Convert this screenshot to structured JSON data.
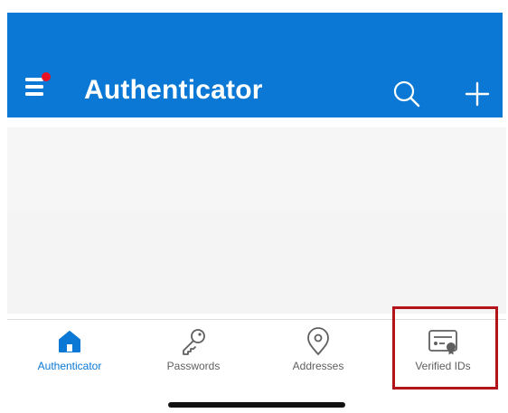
{
  "header": {
    "title": "Authenticator",
    "menu_icon": "hamburger-menu-icon",
    "notification_dot_color": "#e81123",
    "search_icon": "search-icon",
    "add_icon": "plus-icon",
    "background_color": "#0a78d4"
  },
  "tabs": [
    {
      "label": "Authenticator",
      "icon": "home-icon",
      "active": true
    },
    {
      "label": "Passwords",
      "icon": "key-icon",
      "active": false
    },
    {
      "label": "Addresses",
      "icon": "location-pin-icon",
      "active": false
    },
    {
      "label": "Verified IDs",
      "icon": "id-card-icon",
      "active": false
    }
  ],
  "colors": {
    "accent": "#0a78d4",
    "highlight_border": "#b3141b",
    "inactive_tab": "#5f5f5f"
  }
}
